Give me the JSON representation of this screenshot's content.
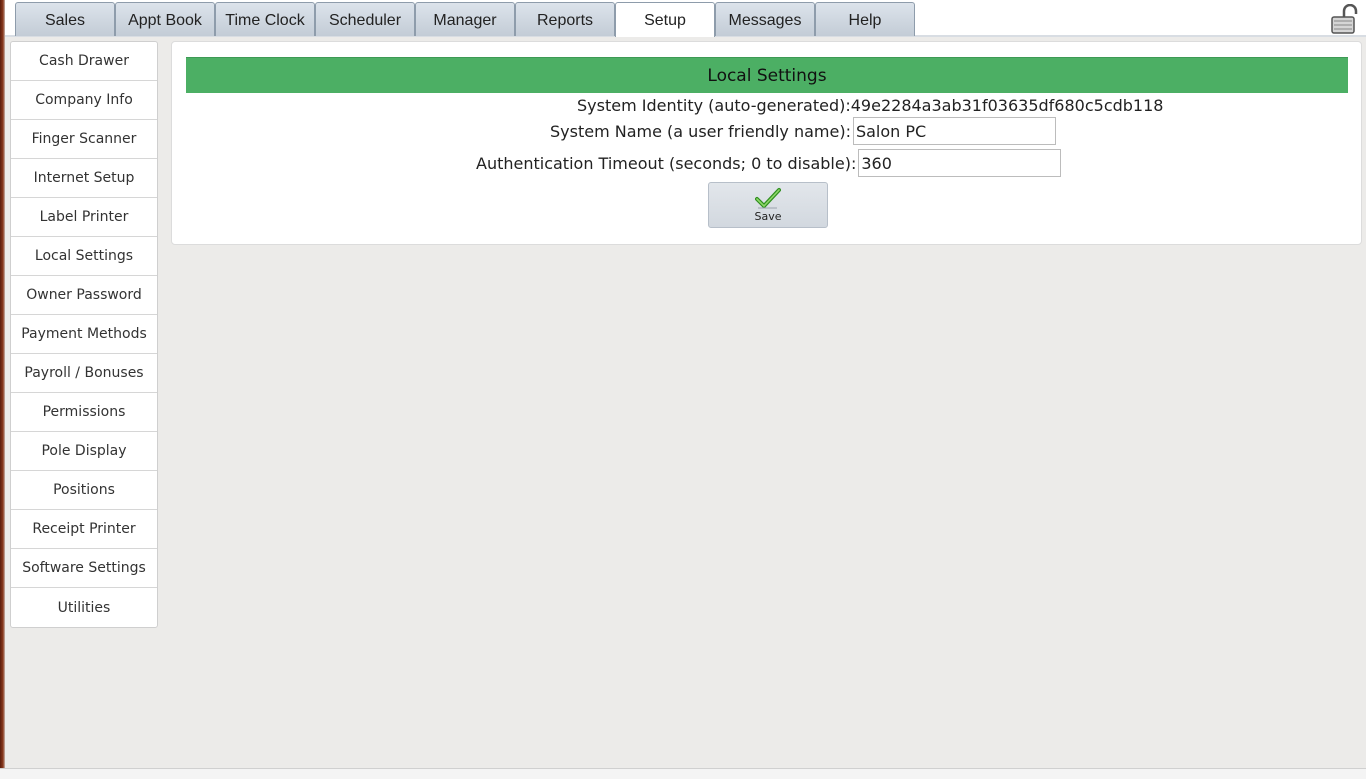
{
  "tabs": [
    {
      "label": "Sales",
      "active": false
    },
    {
      "label": "Appt Book",
      "active": false
    },
    {
      "label": "Time Clock",
      "active": false
    },
    {
      "label": "Scheduler",
      "active": false
    },
    {
      "label": "Manager",
      "active": false
    },
    {
      "label": "Reports",
      "active": false
    },
    {
      "label": "Setup",
      "active": true
    },
    {
      "label": "Messages",
      "active": false
    },
    {
      "label": "Help",
      "active": false
    }
  ],
  "sidebar": {
    "items": [
      {
        "label": "Cash Drawer"
      },
      {
        "label": "Company Info"
      },
      {
        "label": "Finger Scanner"
      },
      {
        "label": "Internet Setup"
      },
      {
        "label": "Label Printer"
      },
      {
        "label": "Local Settings"
      },
      {
        "label": "Owner Password"
      },
      {
        "label": "Payment Methods"
      },
      {
        "label": "Payroll / Bonuses"
      },
      {
        "label": "Permissions"
      },
      {
        "label": "Pole Display"
      },
      {
        "label": "Positions"
      },
      {
        "label": "Receipt Printer"
      },
      {
        "label": "Software Settings"
      },
      {
        "label": "Utilities"
      }
    ]
  },
  "panel": {
    "title": "Local Settings",
    "system_identity_label": "System Identity (auto-generated):",
    "system_identity_value": "49e2284a3ab31f03635df680c5cdb118",
    "system_name_label": "System Name (a user friendly name):",
    "system_name_value": "Salon PC",
    "auth_timeout_label": "Authentication Timeout (seconds; 0 to disable):",
    "auth_timeout_value": "360",
    "save_label": "Save"
  },
  "icons": {
    "lock": "unlocked-padlock-icon",
    "save": "green-checkmark-icon"
  },
  "colors": {
    "header_green": "#4caf64",
    "tab_bg": "#c3ccd6",
    "page_bg": "#ecebe9"
  }
}
